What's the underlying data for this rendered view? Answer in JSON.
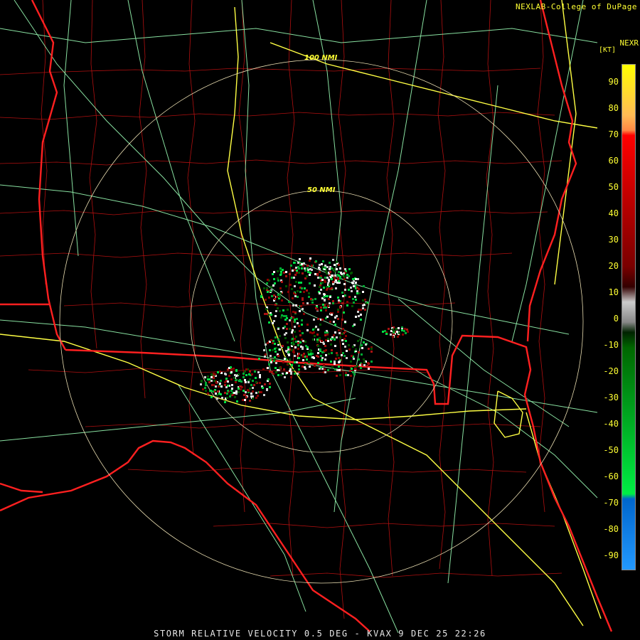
{
  "header": {
    "credit": "NEXLAB-College of DuPage",
    "product_code": "NEXR",
    "units": "[KT]"
  },
  "footer": {
    "caption": "STORM RELATIVE VELOCITY 0.5 DEG - KVAX 9 DEC 25 22:26"
  },
  "range_rings": [
    {
      "label": "50 NMI"
    },
    {
      "label": "100 NMI"
    }
  ],
  "color_scale": {
    "ticks": [
      "90",
      "80",
      "70",
      "60",
      "50",
      "40",
      "30",
      "20",
      "10",
      "0",
      "-10",
      "-20",
      "-30",
      "-40",
      "-50",
      "-60",
      "-70",
      "-80",
      "-90"
    ],
    "colors": {
      "top": "#ffff00",
      "upper": "#ff8844",
      "red": "#ff0000",
      "dark_red": "#7a0000",
      "zero": "#888888",
      "dark_green": "#006600",
      "green": "#00ee44",
      "blue": "#0066cc",
      "light_blue": "#2299ff"
    }
  },
  "map_colors": {
    "state_border": "#ff2020",
    "county_line": "#b01010",
    "road": "#88e0a0",
    "interstate": "#ffff44",
    "ring": "#e8dcb0"
  }
}
